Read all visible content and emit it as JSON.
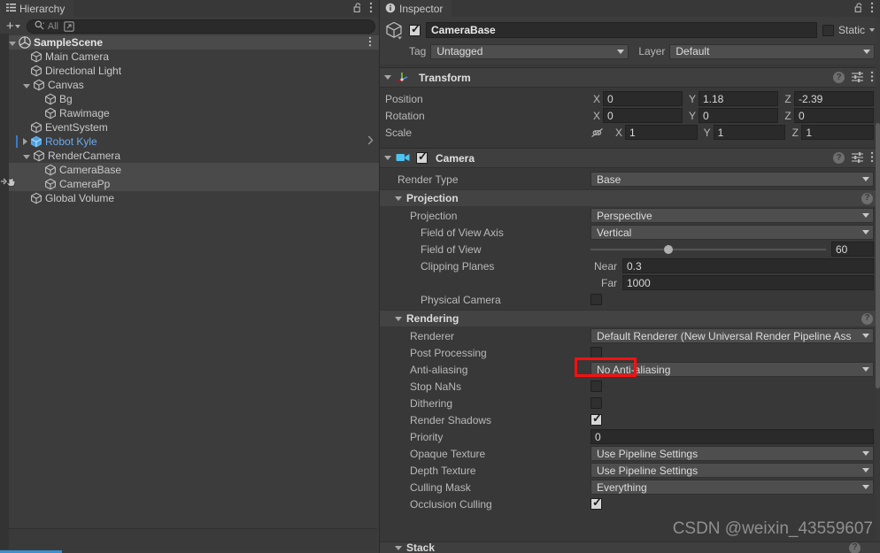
{
  "hierarchy": {
    "tab_label": "Hierarchy",
    "lock_icon": "open-padlock-icon",
    "menu_icon": "kebab-menu-icon",
    "toolbar": {
      "add_label": "+",
      "search_placeholder": "All",
      "search_icon": "search-icon",
      "expand_icon": "open-in-new-icon"
    },
    "items": [
      {
        "label": "SampleScene",
        "depth": 0,
        "icon": "unity-scene-icon",
        "expanded": true,
        "state": "scene",
        "kebab": "⋮"
      },
      {
        "label": "Main Camera",
        "depth": 1,
        "icon": "gameobject-cube-icon",
        "expanded": null,
        "state": "normal"
      },
      {
        "label": "Directional Light",
        "depth": 1,
        "icon": "gameobject-cube-icon",
        "expanded": null,
        "state": "normal"
      },
      {
        "label": "Canvas",
        "depth": 1,
        "icon": "gameobject-cube-icon",
        "expanded": true,
        "state": "normal"
      },
      {
        "label": "Bg",
        "depth": 2,
        "icon": "gameobject-cube-icon",
        "expanded": null,
        "state": "normal"
      },
      {
        "label": "Rawimage",
        "depth": 2,
        "icon": "gameobject-cube-icon",
        "expanded": null,
        "state": "normal"
      },
      {
        "label": "EventSystem",
        "depth": 1,
        "icon": "gameobject-cube-icon",
        "expanded": null,
        "state": "normal"
      },
      {
        "label": "Robot Kyle",
        "depth": 1,
        "icon": "prefab-cube-icon",
        "expanded": false,
        "state": "prefab",
        "chevron": "›"
      },
      {
        "label": "RenderCamera",
        "depth": 1,
        "icon": "gameobject-cube-icon",
        "expanded": true,
        "state": "normal"
      },
      {
        "label": "CameraBase",
        "depth": 2,
        "icon": "gameobject-cube-icon",
        "expanded": null,
        "state": "selected"
      },
      {
        "label": "CameraPp",
        "depth": 2,
        "icon": "gameobject-cube-icon",
        "expanded": null,
        "state": "selected"
      },
      {
        "label": "Global Volume",
        "depth": 1,
        "icon": "gameobject-cube-icon",
        "expanded": null,
        "state": "normal"
      }
    ]
  },
  "inspector": {
    "tab_label": "Inspector",
    "tab_icon": "info-icon",
    "lock_icon": "open-padlock-icon",
    "menu_icon": "kebab-menu-icon",
    "object": {
      "enabled": true,
      "name": "CameraBase",
      "static_label": "Static",
      "static_checked": false,
      "tag_label": "Tag",
      "tag_value": "Untagged",
      "layer_label": "Layer",
      "layer_value": "Default"
    },
    "transform": {
      "title": "Transform",
      "icon": "transform-axis-icon",
      "expanded": true,
      "rows": [
        {
          "label": "Position",
          "x": "0",
          "y": "1.18",
          "z": "-2.39",
          "link": false
        },
        {
          "label": "Rotation",
          "x": "0",
          "y": "0",
          "z": "0",
          "link": false
        },
        {
          "label": "Scale",
          "x": "1",
          "y": "1",
          "z": "1",
          "link": true,
          "link_icon": "constrain-proportions-off-icon"
        }
      ],
      "axis_labels": [
        "X",
        "Y",
        "Z"
      ]
    },
    "camera": {
      "title": "Camera",
      "icon": "camera-icon",
      "enabled": true,
      "expanded": true,
      "render_type_label": "Render Type",
      "render_type_value": "Base",
      "projection_section": {
        "title": "Projection",
        "rows": [
          {
            "label": "Projection",
            "type": "dropdown",
            "value": "Perspective",
            "indent": 2
          },
          {
            "label": "Field of View Axis",
            "type": "dropdown",
            "value": "Vertical",
            "indent": 3
          },
          {
            "label": "Field of View",
            "type": "slider",
            "value": "60",
            "percent": 33,
            "indent": 3
          },
          {
            "label": "Clipping Planes",
            "type": "pair",
            "sub1": "Near",
            "value1": "0.3",
            "sub2": "Far",
            "value2": "1000",
            "indent": 3
          },
          {
            "label": "Physical Camera",
            "type": "checkbox",
            "checked": false,
            "indent": 3
          }
        ]
      },
      "rendering_section": {
        "title": "Rendering",
        "rows": [
          {
            "label": "Renderer",
            "type": "dropdown",
            "value": "Default Renderer (New Universal Render Pipeline Ass",
            "indent": 2
          },
          {
            "label": "Post Processing",
            "type": "checkbox",
            "checked": false,
            "indent": 2,
            "highlight": true
          },
          {
            "label": "Anti-aliasing",
            "type": "dropdown",
            "value": "No Anti-aliasing",
            "indent": 2
          },
          {
            "label": "Stop NaNs",
            "type": "checkbox",
            "checked": false,
            "indent": 2
          },
          {
            "label": "Dithering",
            "type": "checkbox",
            "checked": false,
            "indent": 2
          },
          {
            "label": "Render Shadows",
            "type": "checkbox",
            "checked": true,
            "indent": 2
          },
          {
            "label": "Priority",
            "type": "number",
            "value": "0",
            "indent": 2
          },
          {
            "label": "Opaque Texture",
            "type": "dropdown",
            "value": "Use Pipeline Settings",
            "indent": 2
          },
          {
            "label": "Depth Texture",
            "type": "dropdown",
            "value": "Use Pipeline Settings",
            "indent": 2
          },
          {
            "label": "Culling Mask",
            "type": "dropdown",
            "value": "Everything",
            "indent": 2
          },
          {
            "label": "Occlusion Culling",
            "type": "checkbox",
            "checked": true,
            "indent": 2
          }
        ]
      },
      "stack_section": {
        "title": "Stack"
      }
    }
  },
  "watermark": "CSDN @weixin_43559607",
  "colors": {
    "panel_bg": "#3c3c3c",
    "inspector_bg": "#383838",
    "selection_row": "#4a4a4a",
    "prefab_blue": "#6aabee",
    "accent_blue": "#3a8fd0",
    "highlight_red": "#ff0f0f",
    "camera_icon_blue": "#4ec2f0"
  }
}
